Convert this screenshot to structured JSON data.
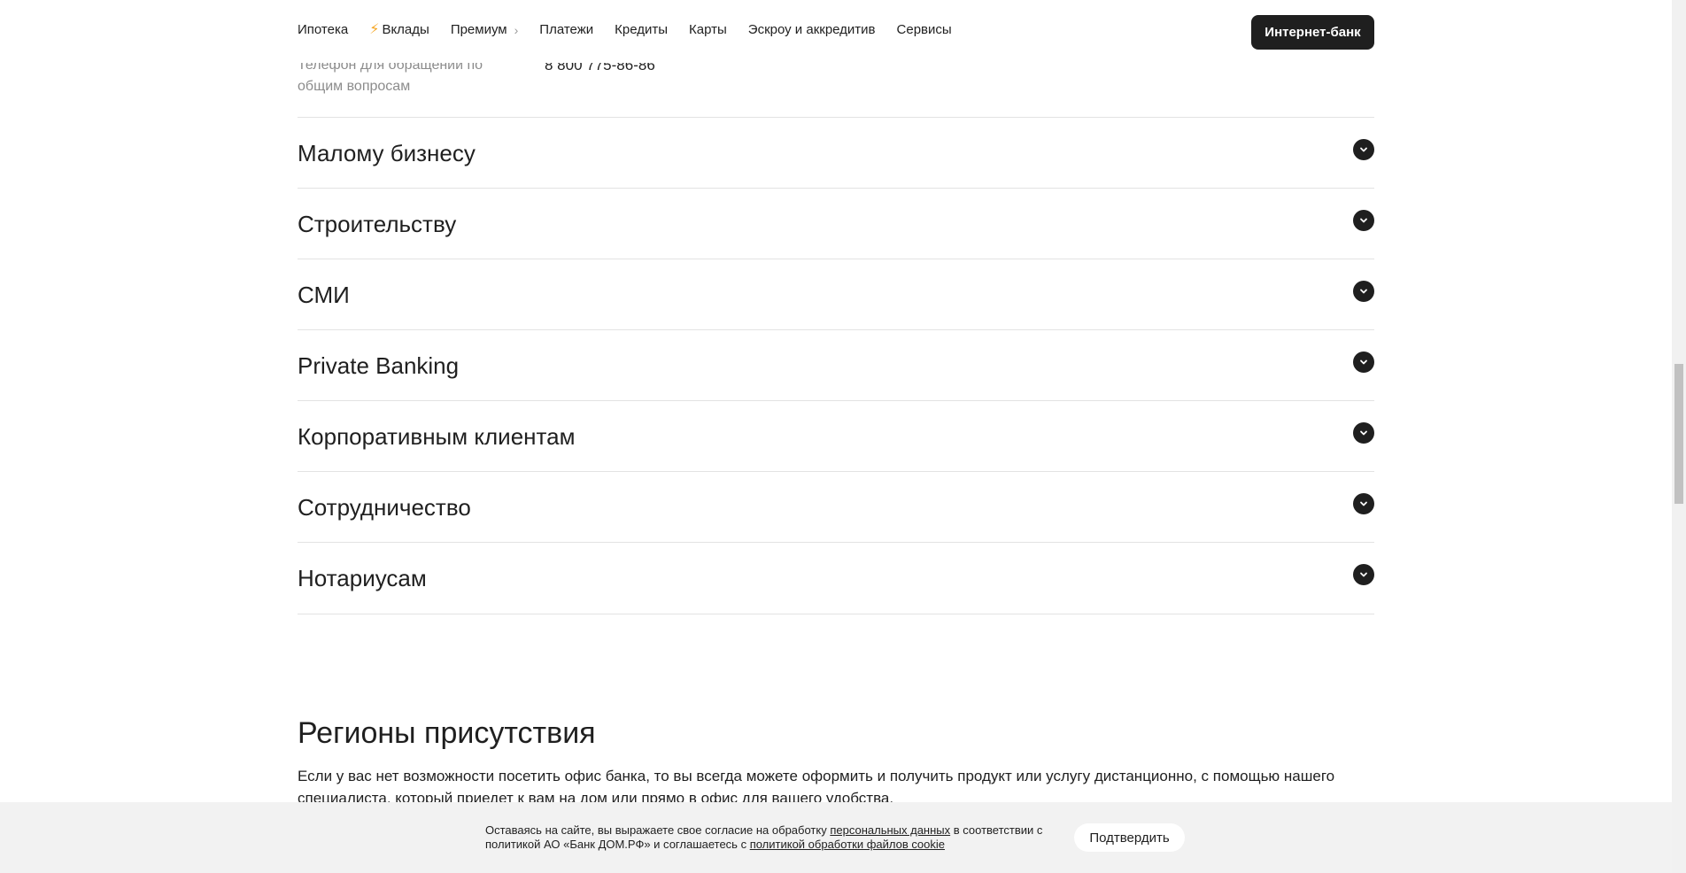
{
  "header": {
    "nav": [
      {
        "label": "Ипотека",
        "icon": null,
        "chevron": false
      },
      {
        "label": "Вклады",
        "icon": "lightning-icon",
        "chevron": false
      },
      {
        "label": "Премиум",
        "icon": null,
        "chevron": true
      },
      {
        "label": "Платежи",
        "icon": null,
        "chevron": false
      },
      {
        "label": "Кредиты",
        "icon": null,
        "chevron": false
      },
      {
        "label": "Карты",
        "icon": null,
        "chevron": false
      },
      {
        "label": "Эскроу и аккредитив",
        "icon": null,
        "chevron": false
      },
      {
        "label": "Сервисы",
        "icon": null,
        "chevron": false
      }
    ],
    "internet_bank_label": "Интернет-банк"
  },
  "contact": {
    "label": "Телефон для обращений по общим вопросам",
    "value": "8 800 775-86-86"
  },
  "accordion": [
    {
      "title": "Малому бизнесу"
    },
    {
      "title": "Строительству"
    },
    {
      "title": "СМИ"
    },
    {
      "title": "Private Banking"
    },
    {
      "title": "Корпоративным клиентам"
    },
    {
      "title": "Сотрудничество"
    },
    {
      "title": "Нотариусам"
    }
  ],
  "regions": {
    "title": "Регионы присутствия",
    "text": "Если у вас нет возможности посетить офис банка, то вы всегда можете оформить и получить продукт или услугу дистанционно, с помощью нашего специалиста, который приедет к вам на дом или прямо в офис для вашего удобства."
  },
  "cookie": {
    "text_1": "Оставаясь на сайте, вы выражаете свое согласие на обработку ",
    "link_1": "персональных данных",
    "text_2": " в соответствии с политикой АО «Банк ДОМ.РФ» и соглашаетесь с ",
    "link_2": "политикой обработки файлов cookie",
    "confirm_label": "Подтвердить"
  },
  "colors": {
    "text": "#1f1f1f",
    "muted": "#8c8c8c",
    "accent_bolt": "#f5a623",
    "divider": "#e3e3e3",
    "banner_bg": "#f2f2f2"
  }
}
